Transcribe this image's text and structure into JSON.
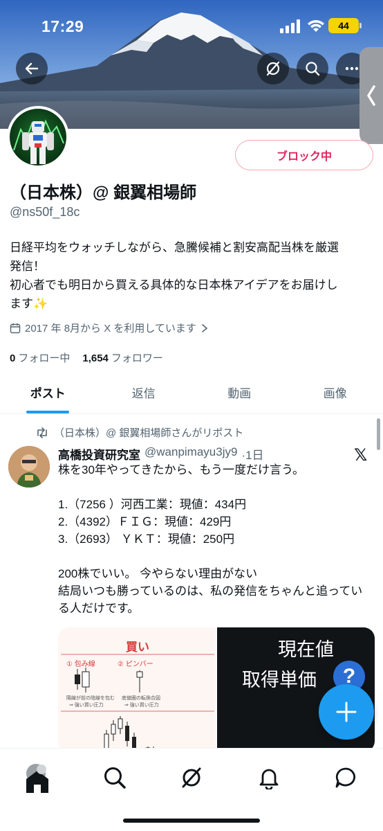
{
  "status_bar": {
    "time": "17:29",
    "battery": "44"
  },
  "profile": {
    "action_button": "ブロック中",
    "display_name": "（日本株）@ 銀翼相場師",
    "handle": "@ns50f_18c",
    "bio_line1": "日経平均をウォッチしながら、急騰候補と割安高配当株を厳選",
    "bio_line2": "発信！",
    "bio_line3": "初心者でも明日から買える具体的な日本株アイデアをお届けし",
    "bio_line4": "ます",
    "bio_emoji": "✨",
    "joined": "2017 年 8月から X を利用しています",
    "following_count": "0",
    "following_label": "フォロー中",
    "followers_count": "1,654",
    "followers_label": "フォロワー"
  },
  "tabs": [
    {
      "label": "ポスト",
      "active": true
    },
    {
      "label": "返信",
      "active": false
    },
    {
      "label": "動画",
      "active": false
    },
    {
      "label": "画像",
      "active": false
    }
  ],
  "post": {
    "repost_label": "（日本株）@ 銀翼相場師さんがリポスト",
    "author": "高橋投資研究室",
    "author_handle": "@wanpimayu3jy9",
    "time": "·1日",
    "text": "株を30年やってきたから、もう一度だけ言う。\n\n1.（7256 ）河西工業：現値：434円\n2.（4392）ＦＩＧ：現値：429円\n3.（2693） ＹＫＴ：現値：250円\n\n200株でいい。 今やらない理由がない\n結局いつも勝っているのは、私の発信をちゃんと追っている人だけです。",
    "media_left": {
      "title": "買い",
      "label1": "① 包み線",
      "label2": "② ピンバー",
      "note1": "陽線が前の陰線を包む",
      "note1b": "⇒ 強い買い圧力",
      "note2": "底値圏の転換合図",
      "note2b": "⇒ 強い買い圧力"
    },
    "media_right": {
      "line1": "現在値",
      "line2": "取得単価",
      "badge": "?"
    }
  },
  "icons": {
    "back": "arrow-left-icon",
    "grok": "grok-icon",
    "search": "search-icon",
    "more": "more-icon",
    "compose": "plus-icon",
    "x_logo": "𝕏"
  },
  "colors": {
    "accent": "#1d9bf0",
    "block": "#e0245e"
  }
}
